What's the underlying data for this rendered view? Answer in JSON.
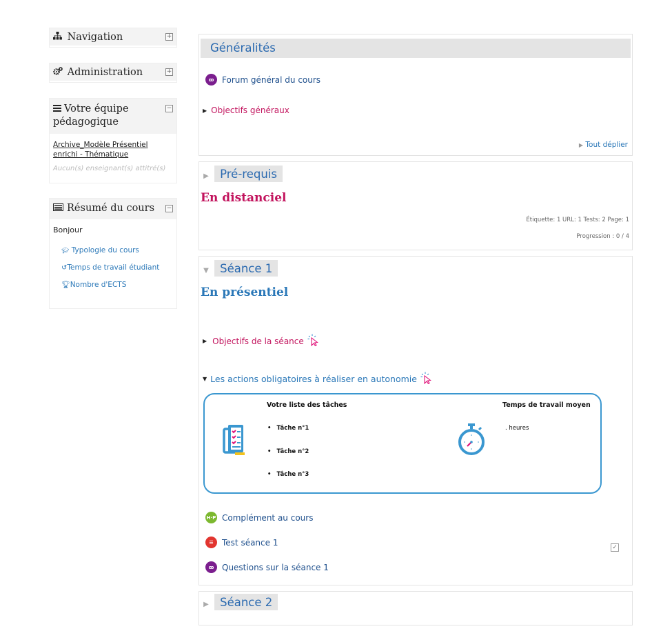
{
  "sidebar": {
    "navigation": {
      "title": "Navigation",
      "icon": "sitemap-icon"
    },
    "administration": {
      "title": "Administration",
      "icon": "cogs-icon"
    },
    "team": {
      "title": "Votre équipe pédagogique",
      "icon": "bars-icon",
      "link": "Archive_Modèle Présentiel enrichi - Thématique",
      "empty": "Aucun(s) enseignant(s) attitré(s)"
    },
    "summary": {
      "title": "Résumé du cours",
      "icon": "list-alt-icon",
      "greeting": "Bonjour",
      "links": [
        {
          "label": "Typologie du cours",
          "icon": "graduation-cap-icon"
        },
        {
          "label": "Temps de travail étudiant",
          "icon": "history-icon"
        },
        {
          "label": "Nombre d'ECTS",
          "icon": "trophy-icon"
        }
      ]
    }
  },
  "main": {
    "generalites": {
      "title": "Généralités",
      "forum": "Forum général du cours",
      "objectifs": "Objectifs généraux",
      "expand_all": "Tout déplier"
    },
    "prerequis": {
      "title": "Pré-requis",
      "heading": "En distanciel",
      "stats": "Étiquette: 1  URL: 1  Tests: 2  Page: 1",
      "progress": "Progression : 0 / 4"
    },
    "seance1": {
      "title": "Séance 1",
      "heading": "En présentiel",
      "objectifs": "Objectifs de la séance",
      "actions": "Les actions obligatoires à réaliser en autonomie",
      "task_list_title": "Votre liste des tâches",
      "tasks": [
        "Tâche n°1",
        "Tâche n°2",
        "Tâche n°3"
      ],
      "time_title": "Temps de travail moyen",
      "time_value": ". heures",
      "complement": "Complément au cours",
      "test": "Test séance 1",
      "questions": "Questions sur la séance 1"
    },
    "seance2": {
      "title": "Séance 2"
    }
  },
  "colors": {
    "link_blue": "#1e4f8c",
    "title_blue": "#2b6ab0",
    "pink": "#c2135d",
    "forum_purple": "#7b1e8e",
    "h5p_green": "#7cb82f",
    "quiz_red": "#e2352f"
  }
}
